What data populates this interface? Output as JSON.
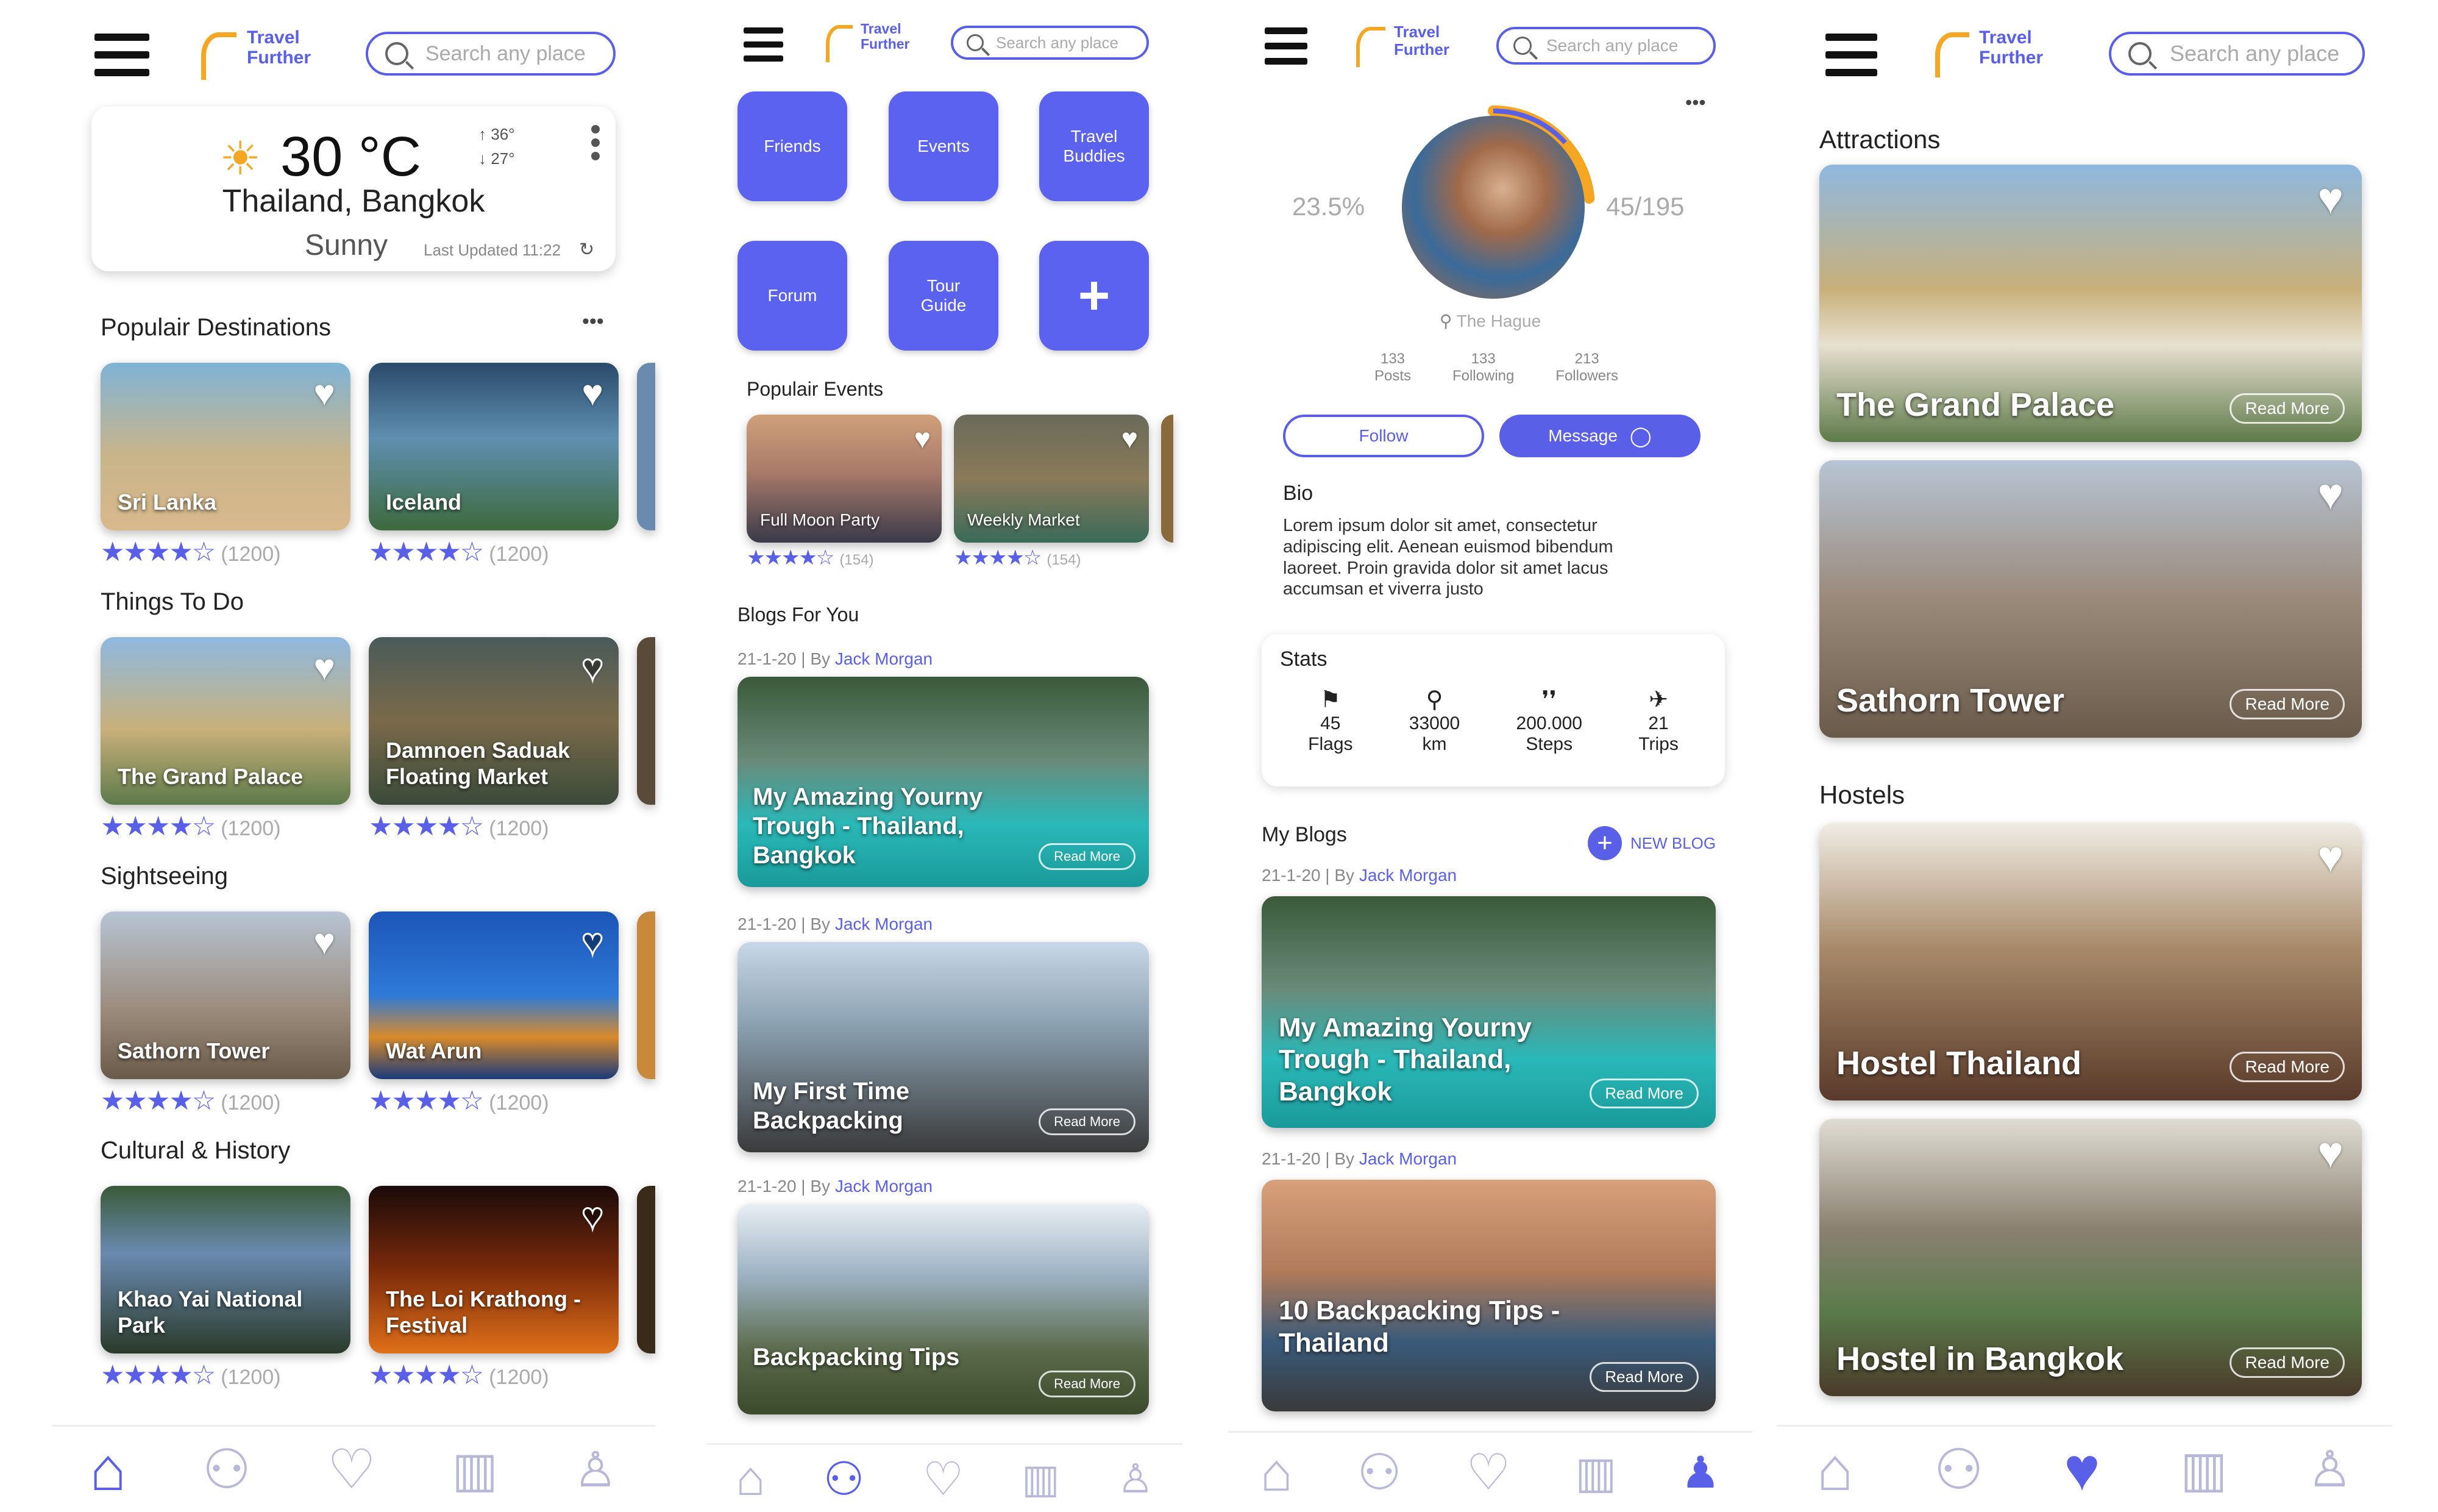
{
  "brand": {
    "line1": "Travel",
    "line2": "Further",
    "color": "#5A5FE8",
    "accent": "#F5A623"
  },
  "search": {
    "placeholder": "Search any place"
  },
  "screen1": {
    "weather": {
      "temp": "30 °C",
      "high": "36°",
      "low": "27°",
      "location": "Thailand, Bangkok",
      "condition": "Sunny",
      "updated": "Last Updated 11:22"
    },
    "sections": [
      {
        "title": "Populair Destinations",
        "more": "•••",
        "cards": [
          {
            "name": "Sri Lanka",
            "count": "(1200)"
          },
          {
            "name": "Iceland",
            "count": "(1200)"
          }
        ]
      },
      {
        "title": "Things To Do",
        "cards": [
          {
            "name": "The Grand Palace",
            "count": "(1200)"
          },
          {
            "name": "Damnoen Saduak Floating Market",
            "count": "(1200)"
          }
        ]
      },
      {
        "title": "Sightseeing",
        "cards": [
          {
            "name": "Sathorn Tower",
            "count": "(1200)"
          },
          {
            "name": "Wat Arun",
            "count": "(1200)"
          }
        ]
      },
      {
        "title": "Cultural & History",
        "cards": [
          {
            "name": "Khao Yai National Park",
            "count": "(1200)"
          },
          {
            "name": "The Loi Krathong - Festival",
            "count": "(1200)"
          }
        ]
      }
    ]
  },
  "screen2": {
    "tiles": [
      "Friends",
      "Events",
      "Travel Buddies",
      "Forum",
      "Tour Guide",
      "+"
    ],
    "events_title": "Populair Events",
    "events": [
      {
        "name": "Full Moon Party",
        "count": "(154)"
      },
      {
        "name": "Weekly Market",
        "count": "(154)"
      }
    ],
    "blogs_title": "Blogs For You",
    "blog_meta_prefix": "21-1-20 | By",
    "author": "Jack Morgan",
    "blogs": [
      {
        "title": "My Amazing Yourny Trough - Thailand, Bangkok"
      },
      {
        "title": "My First Time Backpacking"
      },
      {
        "title": "Backpacking Tips"
      }
    ],
    "read_more": "Read More"
  },
  "screen3": {
    "progress_left": "23.5%",
    "progress_right": "45/195",
    "progress_fraction": 0.235,
    "location": "The Hague",
    "counts": [
      {
        "num": "133",
        "label": "Posts"
      },
      {
        "num": "133",
        "label": "Following"
      },
      {
        "num": "213",
        "label": "Followers"
      }
    ],
    "follow": "Follow",
    "message": "Message",
    "bio_title": "Bio",
    "bio": "Lorem ipsum dolor sit amet, consectetur adipiscing elit. Aenean euismod bibendum laoreet. Proin gravida dolor sit amet lacus accumsan et viverra justo",
    "stats_title": "Stats",
    "stats": [
      {
        "icon": "flag-icon",
        "num": "45",
        "label": "Flags"
      },
      {
        "icon": "walking-icon",
        "num": "33000",
        "label": "km"
      },
      {
        "icon": "footsteps-icon",
        "num": "200.000",
        "label": "Steps"
      },
      {
        "icon": "plane-icon",
        "num": "21",
        "label": "Trips"
      }
    ],
    "blogs_title": "My Blogs",
    "new_blog": "NEW BLOG",
    "blogs": [
      {
        "title": "My Amazing Yourny Trough - Thailand, Bangkok"
      },
      {
        "title": "10 Backpacking Tips - Thailand"
      }
    ]
  },
  "screen4": {
    "attractions_title": "Attractions",
    "attractions": [
      {
        "name": "The Grand Palace"
      },
      {
        "name": "Sathorn Tower"
      }
    ],
    "hostels_title": "Hostels",
    "hostels": [
      {
        "name": "Hostel Thailand"
      },
      {
        "name": "Hostel in Bangkok"
      }
    ]
  },
  "tabs": [
    "home-icon",
    "people-icon",
    "heart-icon",
    "map-icon",
    "profile-icon"
  ]
}
